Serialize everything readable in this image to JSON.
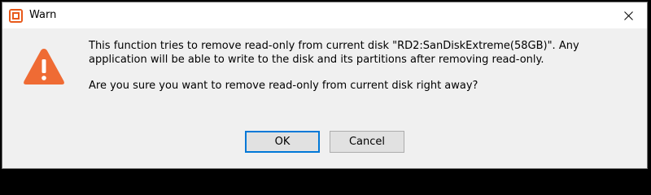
{
  "window": {
    "title": "Warn",
    "app_icon": "partition-tool-logo-icon",
    "close_icon": "close-icon"
  },
  "dialog": {
    "icon": "warning-triangle-icon",
    "accent_color": "#e8591a",
    "message_line1": "This function tries to remove read-only from current disk \"RD2:SanDiskExtreme(58GB)\". Any application will be able to write to the disk and its partitions after removing read-only.",
    "question": "Are you sure you want to remove read-only from current disk right away?"
  },
  "buttons": {
    "ok_label": "OK",
    "cancel_label": "Cancel",
    "focus_color": "#0078d7"
  }
}
